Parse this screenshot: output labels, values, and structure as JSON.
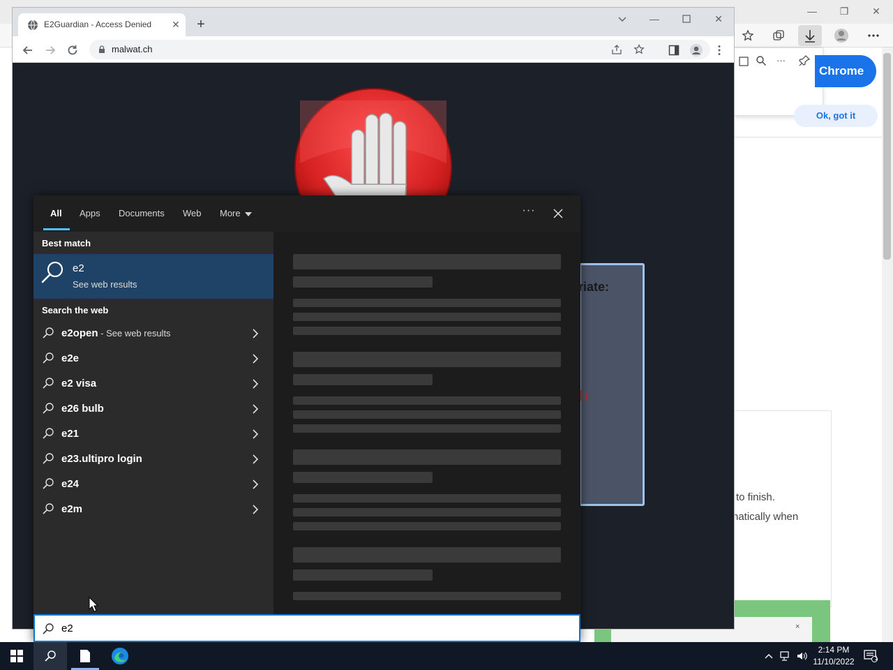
{
  "edge_window": {
    "get_chrome_label": "Chrome",
    "ok_button_label": "Ok, got it",
    "text_finish": "to finish.",
    "text_auto": "natically when",
    "green_close": "×"
  },
  "chrome": {
    "tab_title": "E2Guardian - Access Denied",
    "tab_close": "✕",
    "new_tab": "+",
    "url": "malwat.ch"
  },
  "blocked_page": {
    "heading_fragment": "riate:",
    "red_fragment": "h"
  },
  "search_panel": {
    "tabs": [
      {
        "label": "All"
      },
      {
        "label": "Apps"
      },
      {
        "label": "Documents"
      },
      {
        "label": "Web"
      },
      {
        "label": "More"
      }
    ],
    "options_label": "···",
    "best_match_header": "Best match",
    "best_match": {
      "title": "e2",
      "subtitle": "See web results"
    },
    "search_web_header": "Search the web",
    "suggestions": [
      {
        "text": "e2open",
        "desc": " - See web results"
      },
      {
        "text": "e2e",
        "desc": ""
      },
      {
        "text": "e2 visa",
        "desc": ""
      },
      {
        "text": "e26 bulb",
        "desc": ""
      },
      {
        "text": "e21",
        "desc": ""
      },
      {
        "text": "e23.ultipro login",
        "desc": ""
      },
      {
        "text": "e24",
        "desc": ""
      },
      {
        "text": "e2m",
        "desc": ""
      }
    ],
    "query": "e2"
  },
  "taskbar": {
    "time": "2:14 PM",
    "date": "11/10/2022",
    "notification_count": "1"
  },
  "colors": {
    "accent_blue": "#0078d4",
    "selection_blue": "#1e4366",
    "tab_underline": "#4cc2ff",
    "stop_red": "#d42020",
    "taskbar_bg": "#101826"
  }
}
